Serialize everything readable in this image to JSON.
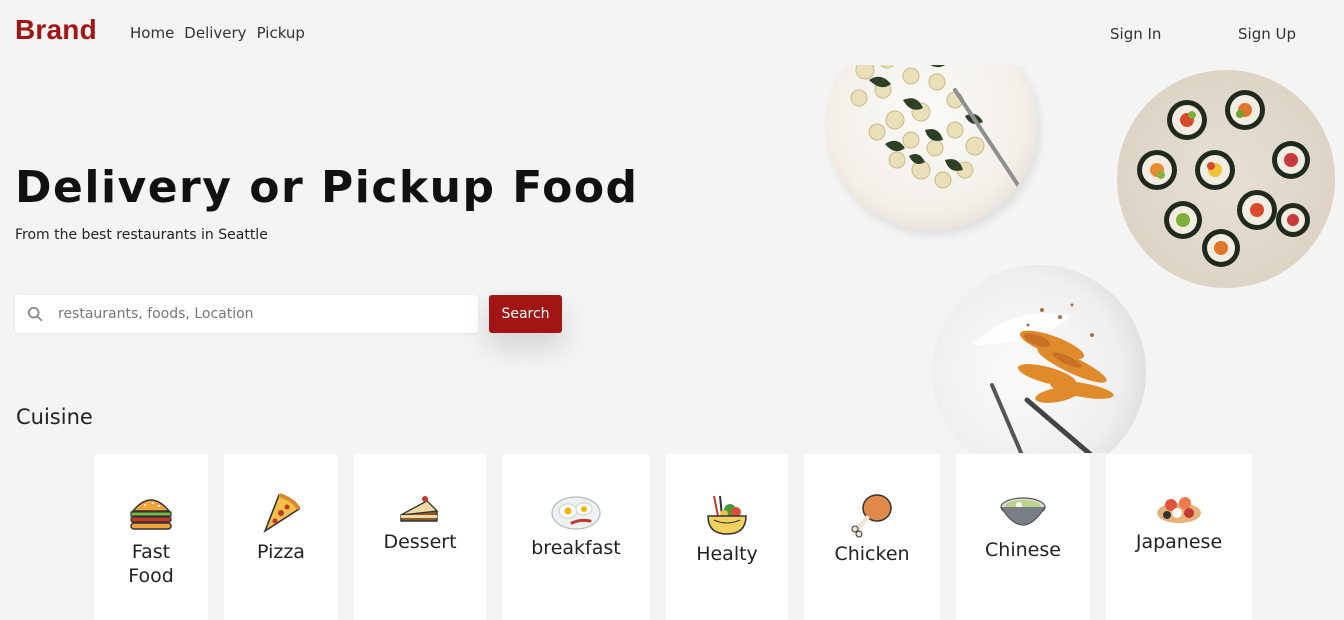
{
  "header": {
    "brand": "Brand",
    "nav": [
      "Home",
      "Delivery",
      "Pickup"
    ],
    "sign_in": "Sign In",
    "sign_up": "Sign Up"
  },
  "hero": {
    "title": "Delivery or Pickup Food",
    "subtitle": "From the best restaurants in Seattle"
  },
  "search": {
    "placeholder": "restaurants, foods, Location",
    "button": "Search"
  },
  "cuisine": {
    "title": "Cuisine",
    "items": [
      {
        "label": "Fast Food",
        "icon": "burger-icon"
      },
      {
        "label": "Pizza",
        "icon": "pizza-icon"
      },
      {
        "label": "Dessert",
        "icon": "cake-icon"
      },
      {
        "label": "breakfast",
        "icon": "eggs-icon"
      },
      {
        "label": "Healty",
        "icon": "salad-icon"
      },
      {
        "label": "Chicken",
        "icon": "drumstick-icon"
      },
      {
        "label": "Chinese",
        "icon": "bowl-icon"
      },
      {
        "label": "Japanese",
        "icon": "sushi-icon"
      }
    ]
  },
  "colors": {
    "accent": "#a31414",
    "background": "#f4f4f4"
  }
}
